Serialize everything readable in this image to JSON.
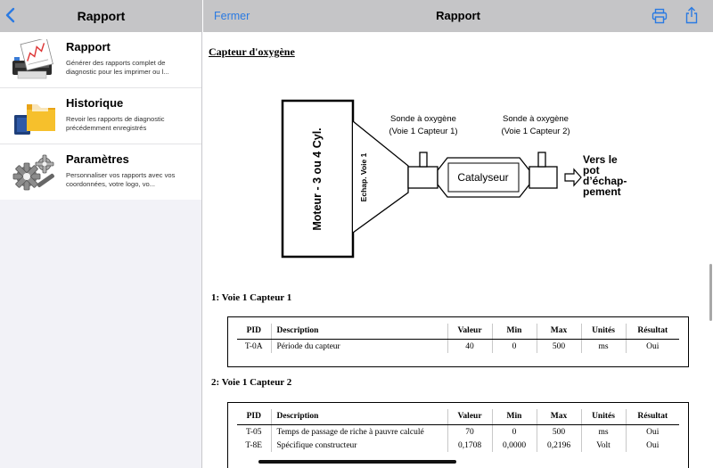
{
  "sidebar": {
    "title": "Rapport",
    "back_icon": "chevron-left-icon",
    "items": [
      {
        "title": "Rapport",
        "desc": "Générer des rapports complet de diagnostic pour les imprimer ou l...",
        "icon": "printer-report-icon"
      },
      {
        "title": "Historique",
        "desc": "Revoir les rapports de diagnostic précédemment enregistrés",
        "icon": "folder-icon"
      },
      {
        "title": "Paramètres",
        "desc": "Personnaliser vos rapports avec vos coordonnées, votre logo, vo...",
        "icon": "gears-icon"
      }
    ]
  },
  "main": {
    "close_label": "Fermer",
    "title": "Rapport",
    "print_icon": "print-icon",
    "share_icon": "share-icon"
  },
  "document": {
    "heading": "Capteur d'oxygène",
    "diagram": {
      "engine": "Moteur - 3 ou 4 Cyl.",
      "exhaust": "Echap. Voie 1",
      "sensor1_line1": "Sonde à oxygène",
      "sensor1_line2": "(Voie 1 Capteur 1)",
      "sensor2_line1": "Sonde à oxygène",
      "sensor2_line2": "(Voie 1 Capteur 2)",
      "catalyst": "Catalyseur",
      "tail_line1": "Vers le",
      "tail_line2": "pot",
      "tail_line3": "d’échap-",
      "tail_line4": "pement"
    },
    "headers": {
      "pid": "PID",
      "description": "Description",
      "value": "Valeur",
      "min": "Min",
      "max": "Max",
      "units": "Unités",
      "result": "Résultat"
    },
    "section1": {
      "title": "1: Voie 1 Capteur 1",
      "rows": [
        {
          "pid": "T-0A",
          "description": "Période du capteur",
          "value": "40",
          "min": "0",
          "max": "500",
          "units": "ms",
          "result": "Oui"
        }
      ]
    },
    "section2": {
      "title": "2: Voie 1 Capteur 2",
      "rows": [
        {
          "pid": "T-05",
          "description": "Temps de passage de riche à pauvre calculé",
          "value": "70",
          "min": "0",
          "max": "500",
          "units": "ms",
          "result": "Oui"
        },
        {
          "pid": "T-8E",
          "description": "Spécifique constructeur",
          "value": "0,1708",
          "min": "0,0000",
          "max": "0,2196",
          "units": "Volt",
          "result": "Oui"
        }
      ]
    }
  },
  "colors": {
    "accent": "#2a7ae2",
    "bar": "#c5c5c7",
    "sidebar_bg": "#f2f2f7"
  }
}
